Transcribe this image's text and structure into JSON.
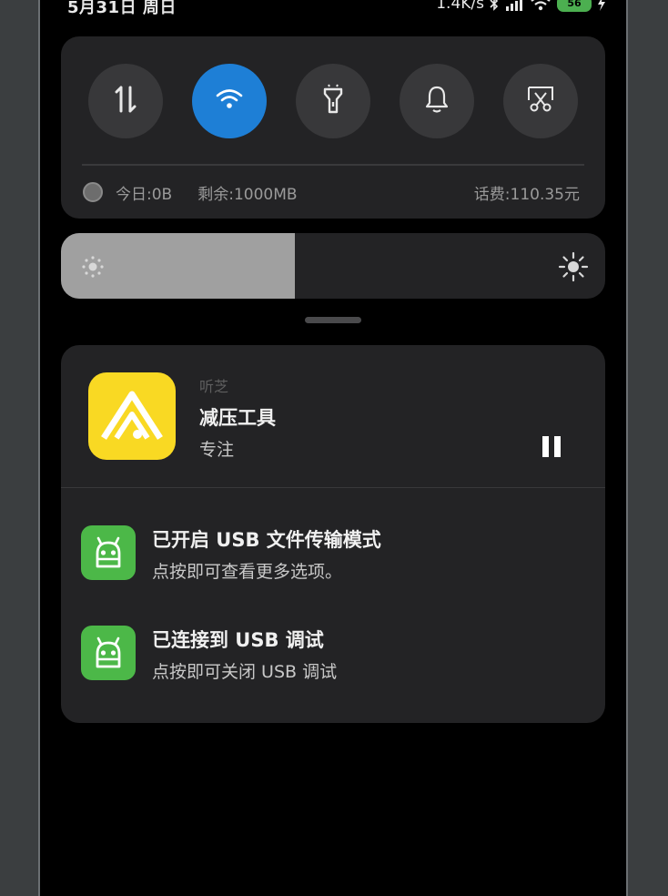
{
  "status_bar": {
    "datetime": "5月31日 周日",
    "net_speed": "1.4K/s",
    "battery_level": "56",
    "icons": [
      "bluetooth-icon",
      "signal-icon",
      "wifi-icon",
      "battery-icon",
      "charging-icon"
    ]
  },
  "quick_settings": {
    "tiles": [
      {
        "name": "mobile-data",
        "icon": "data-arrows-icon",
        "active": false
      },
      {
        "name": "wifi",
        "icon": "wifi-icon",
        "active": true
      },
      {
        "name": "flashlight",
        "icon": "flashlight-icon",
        "active": false
      },
      {
        "name": "notification",
        "icon": "bell-icon",
        "active": false
      },
      {
        "name": "screenshot",
        "icon": "screenshot-scissors-icon",
        "active": false
      }
    ],
    "data_usage": {
      "today": "今日:0B",
      "remaining": "剩余:1000MB",
      "balance": "话费:110.35元"
    }
  },
  "brightness": {
    "level_percent": 43,
    "icons": [
      "brightness-low-icon",
      "brightness-high-icon"
    ]
  },
  "media_notification": {
    "app_name": "听芝",
    "title": "减压工具",
    "subtitle": "专注",
    "app_icon": "tingzhi-app-icon",
    "control": "pause-icon"
  },
  "notifications": [
    {
      "title": "已开启 USB 文件传输模式",
      "text": "点按即可查看更多选项。",
      "icon": "android-icon"
    },
    {
      "title": "已连接到 USB 调试",
      "text": "点按即可关闭 USB 调试",
      "icon": "android-icon"
    }
  ],
  "colors": {
    "accent": "#1e7fd6",
    "battery": "#4caf50",
    "android": "#4cb848",
    "app_icon": "#f9d923"
  }
}
